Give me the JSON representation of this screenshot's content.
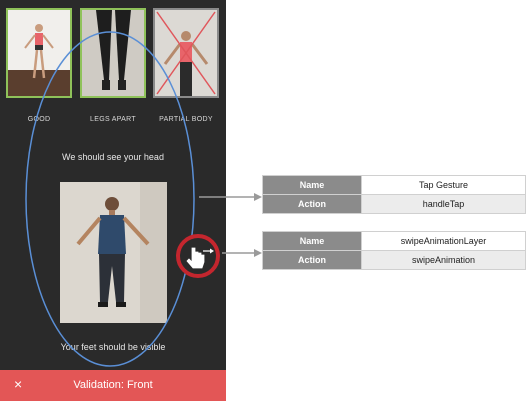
{
  "screen": {
    "close_icon": "×",
    "thumbnails": [
      {
        "label": "GOOD",
        "status": "accepted"
      },
      {
        "label": "LEGS APART",
        "status": "accepted"
      },
      {
        "label": "PARTIAL BODY",
        "status": "rejected"
      }
    ],
    "hint_top": "We should see your head",
    "hint_bottom": "Your feet should be visible",
    "bottom_bar": {
      "close_icon": "×",
      "title": "Validation: Front",
      "color": "#e35656"
    }
  },
  "annotations": [
    {
      "rows": [
        {
          "key": "Name",
          "value": "Tap Gesture"
        },
        {
          "key": "Action",
          "value": "handleTap"
        }
      ]
    },
    {
      "rows": [
        {
          "key": "Name",
          "value": "swipeAnimationLayer"
        },
        {
          "key": "Action",
          "value": "swipeAnimation"
        }
      ]
    }
  ],
  "colors": {
    "accent_green": "#8fc25a",
    "reject_red": "#e0565b",
    "gesture_ring": "#c4262e",
    "ellipse_blue": "#5a8fd6"
  },
  "icons": {
    "gesture": "hand-pointer-icon",
    "swipe": "swipe-arrow-icon"
  }
}
